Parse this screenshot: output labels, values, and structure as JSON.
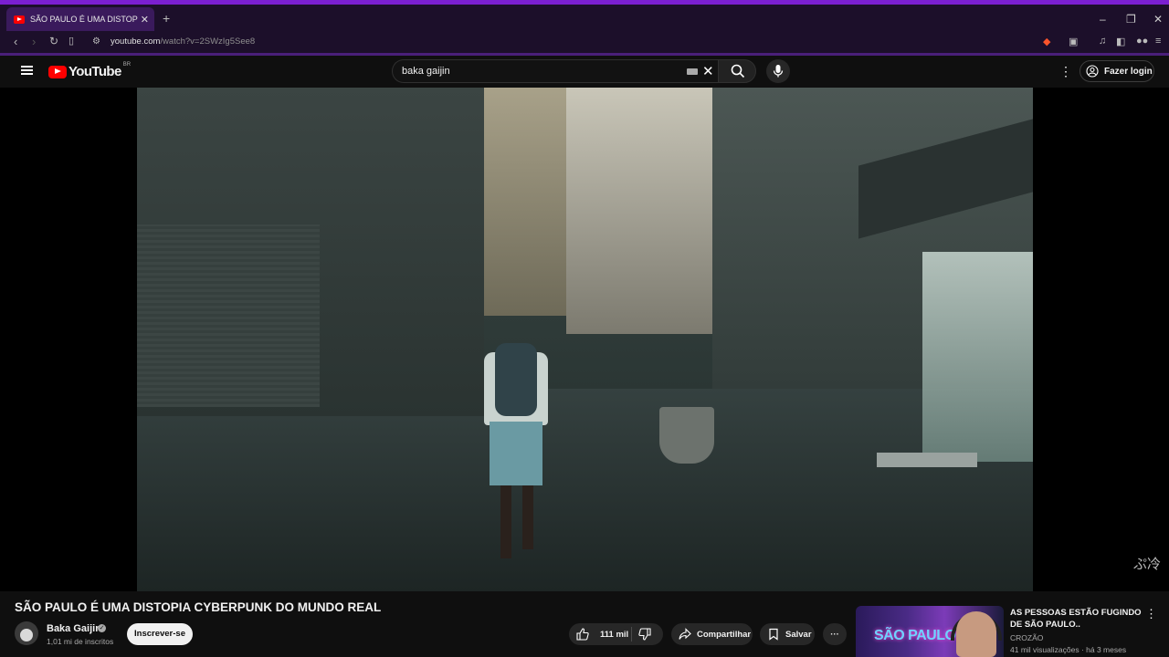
{
  "browser": {
    "tab_title": "SÃO PAULO É UMA DISTOPIA CY",
    "tab_close": "✕",
    "new_tab": "+",
    "window": {
      "minimize": "–",
      "restore": "❐",
      "close": "✕"
    },
    "url_host": "youtube.com",
    "url_path": "/watch?v=2SWzIg5See8",
    "accent": "#7b1fd1"
  },
  "youtube": {
    "wordmark": "YouTube",
    "country_code": "BR",
    "search_query": "baka gaijin",
    "search_clear": "✕",
    "login_label": "Fazer login",
    "more": "⋮"
  },
  "video": {
    "title": "SÃO PAULO É UMA DISTOPIA CYBERPUNK DO MUNDO REAL",
    "watermark": "ぷ冷"
  },
  "channel": {
    "name": "Baka Gaijin",
    "verified": "✓",
    "subscribers": "1,01 mi de inscritos",
    "subscribe_label": "Inscrever-se"
  },
  "actions": {
    "likes": "111 mil",
    "share": "Compartilhar",
    "save": "Salvar",
    "more": "···"
  },
  "recommended": {
    "title": "AS PESSOAS ESTÃO FUGINDO DE SÃO PAULO..",
    "channel": "CROZÃO",
    "meta": "41 mil visualizações · há 3 meses",
    "thumb_text": "SÃO PAULO",
    "more": "⋮"
  }
}
